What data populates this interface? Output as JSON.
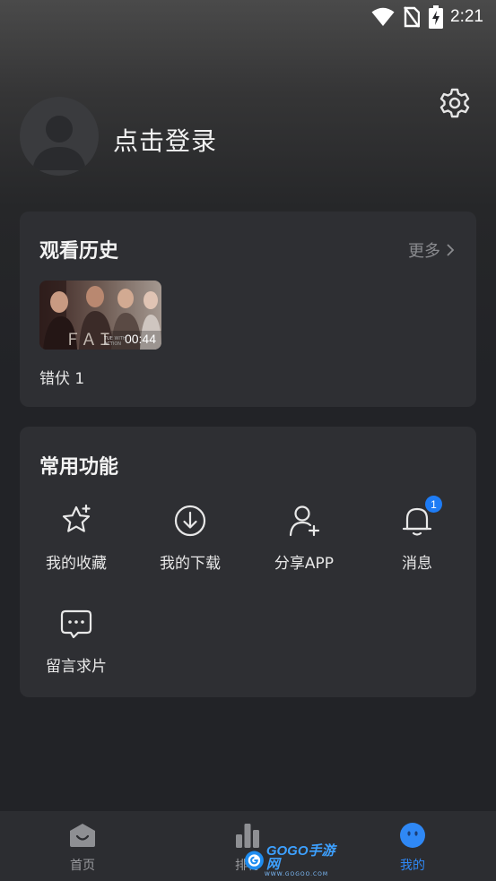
{
  "status_bar": {
    "time": "2:21",
    "icons": [
      "wifi-icon",
      "no-sim-icon",
      "battery-charging-icon"
    ]
  },
  "profile": {
    "login_text": "点击登录",
    "settings_icon": "gear-icon",
    "avatar_icon": "default-avatar-icon"
  },
  "history": {
    "title": "观看历史",
    "more_label": "更多",
    "items": [
      {
        "name": "错伏 1",
        "duration": "00:44"
      }
    ]
  },
  "functions": {
    "title": "常用功能",
    "items": [
      {
        "label": "我的收藏",
        "icon": "star-plus-icon"
      },
      {
        "label": "我的下载",
        "icon": "download-icon"
      },
      {
        "label": "分享APP",
        "icon": "add-user-icon"
      },
      {
        "label": "消息",
        "icon": "bell-icon",
        "badge": "1"
      },
      {
        "label": "留言求片",
        "icon": "message-icon"
      }
    ]
  },
  "tabbar": {
    "tabs": [
      {
        "label": "首页",
        "icon": "home-icon"
      },
      {
        "label": "排行",
        "icon": "ranking-icon"
      },
      {
        "label": "我的",
        "icon": "profile-face-icon",
        "active": true
      }
    ]
  },
  "watermark": {
    "text": "GOGO手游网",
    "sub": "WWW.GOGOO.COM"
  },
  "colors": {
    "background": "#222327",
    "card": "#2e2f33",
    "accent": "#2f88f5",
    "badge": "#1e7cf5"
  }
}
